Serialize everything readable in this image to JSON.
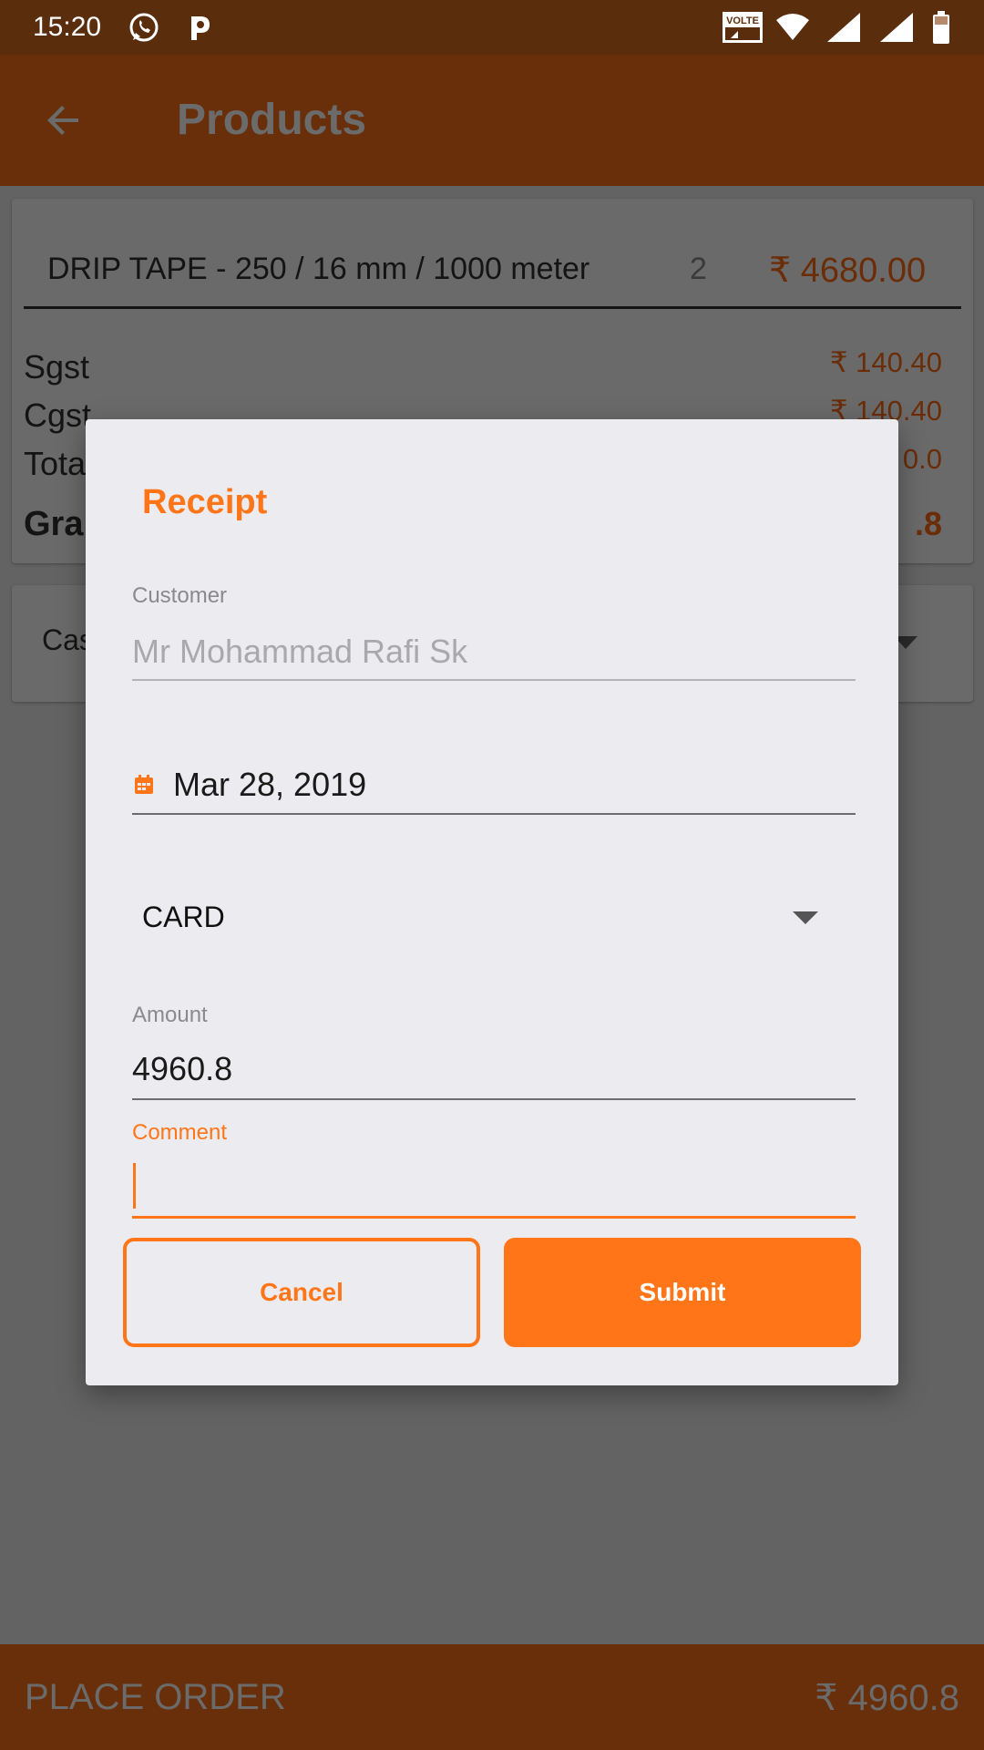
{
  "status_bar": {
    "time": "15:20",
    "network_label": "VOLTE"
  },
  "app_bar": {
    "title": "Products"
  },
  "product": {
    "name": "DRIP TAPE - 250 / 16 mm / 1000 meter",
    "qty": "2",
    "price": "₹ 4680.00"
  },
  "summary": [
    {
      "label": "Sgst",
      "value": "₹ 140.40"
    },
    {
      "label": "Cgst",
      "value": "₹ 140.40"
    },
    {
      "label": "Tota",
      "value": "0.0"
    },
    {
      "label": "Gra",
      "value": ".8"
    }
  ],
  "payment_card": {
    "visible_label": "Cas"
  },
  "dialog": {
    "title": "Receipt",
    "customer_label": "Customer",
    "customer_value": "Mr Mohammad Rafi Sk",
    "date_value": "Mar 28, 2019",
    "payment_mode": "CARD",
    "amount_label": "Amount",
    "amount_value": "4960.8",
    "comment_label": "Comment",
    "comment_value": "",
    "cancel_label": "Cancel",
    "submit_label": "Submit"
  },
  "bottom_bar": {
    "place_order_label": "PLACE ORDER",
    "total": "₹ 4960.8"
  },
  "colors": {
    "accent": "#ff7518",
    "app_bar": "#682f0a",
    "status_bar": "#5a2d0d"
  }
}
